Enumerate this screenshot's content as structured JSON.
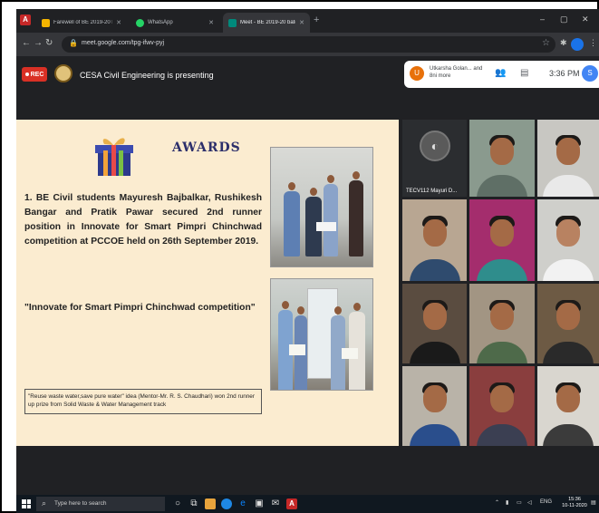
{
  "browser": {
    "tabs": [
      {
        "label": "Farewell of BE 2019-20 batch -...",
        "active": false,
        "color": "#f4b400"
      },
      {
        "label": "WhatsApp",
        "active": false,
        "color": "#25d366"
      },
      {
        "label": "Meet - BE 2019-20 batch to...",
        "active": true,
        "color": "#00897b"
      }
    ],
    "url": "meet.google.com/tpg-ifwv-pyj"
  },
  "meet": {
    "rec_label": "REC",
    "presenting_text": "CESA Civil Engineering is presenting",
    "participant_avatar_letter": "U",
    "participant_names": "Utkarsha Golan... and 8ni more",
    "time": "3:36 PM",
    "self_avatar_letter": "S"
  },
  "slide": {
    "heading": "AWARDS",
    "item_text": "1. BE Civil students Mayuresh Bajbalkar, Rushikesh Bangar and Pratik Pawar secured 2nd runner position in Innovate for Smart Pimpri Chinchwad competition at PCCOE held on 26th September 2019.",
    "quote": "\"Innovate for Smart Pimpri Chinchwad competition\"",
    "caption": "\"Reuse waste water,save pure water\" idea (Mentor-Mr. R. S. Chaudhari) won 2nd runner up prize from Solid Waste & Water Management track"
  },
  "grid": {
    "self_tile_label": "TECV112 Mayuri D..."
  },
  "taskbar": {
    "search_placeholder": "Type here to search",
    "language": "ENG",
    "clock_time": "15:36",
    "clock_date": "10-11-2020"
  }
}
